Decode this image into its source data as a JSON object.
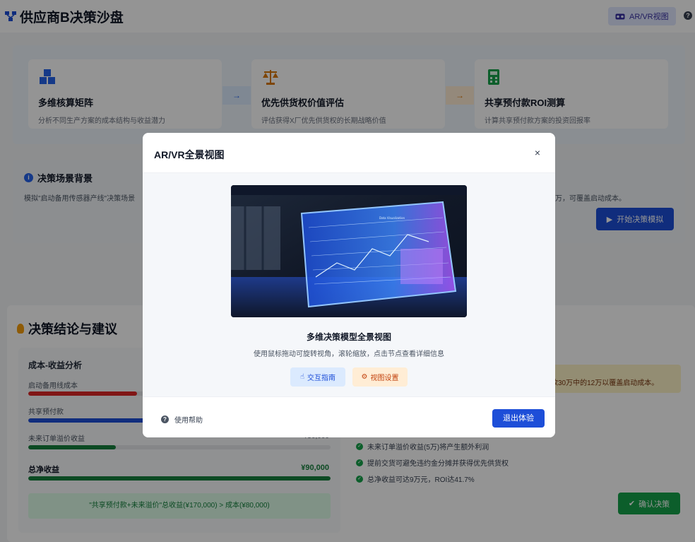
{
  "header": {
    "title": "供应商B决策沙盘",
    "arvr_button": "AR/VR视图",
    "help_icon": "?"
  },
  "steps": [
    {
      "title": "多维核算矩阵",
      "desc": "分析不同生产方案的成本结构与收益潜力",
      "icon": "cubes-icon",
      "color": "#2563eb"
    },
    {
      "title": "优先供货权价值评估",
      "desc": "评估获得X厂优先供货权的长期战略价值",
      "icon": "scale-icon",
      "color": "#d97706"
    },
    {
      "title": "共享预付款ROI测算",
      "desc": "计算共享预付款方案的投资回报率",
      "icon": "calculator-icon",
      "color": "#16a34a"
    }
  ],
  "scene": {
    "title": "决策场景背景",
    "desc": "模拟\"启动备用传感器产线\"决策场景",
    "right_text": "万，可覆盖启动成本。",
    "start_button": "开始决策模拟"
  },
  "result": {
    "title": "决策结论与建议",
    "cost_title": "成本-收益分析",
    "rows": [
      {
        "label": "启动备用线成本",
        "value": "",
        "fill": 0.36,
        "color": "#dc2626"
      },
      {
        "label": "共享预付款",
        "value": "",
        "fill": 0.62,
        "color": "#1d4ed8"
      },
      {
        "label": "未来订单溢价收益",
        "value": "¥50,000",
        "fill": 0.29,
        "color": "#15803d"
      }
    ],
    "net_label": "总净收益",
    "net_value": "¥90,000",
    "formula": "\"共享预付款+未来溢价\"总收益(¥170,000) > 成本(¥80,000)",
    "note": "款30万中的12万以覆盖启动成本。",
    "checks": [
      "未来订单溢价收益(5万)将产生额外利润",
      "提前交货可避免违约金分摊并获得优先供货权",
      "总净收益可达9万元，ROI达41.7%"
    ],
    "confirm_button": "确认决策"
  },
  "modal": {
    "title": "AR/VR全景视图",
    "close": "×",
    "model_title": "多维决策模型全景视图",
    "model_desc": "使用鼠标拖动可旋转视角，滚轮缩放，点击节点查看详细信息",
    "guide_button": "交互指南",
    "settings_button": "视图设置",
    "help_text": "使用帮助",
    "exit_button": "退出体验",
    "screen_label": "Data Visualization"
  },
  "colors": {
    "primary": "#1d4ed8",
    "success": "#16a34a",
    "warning": "#d97706"
  }
}
